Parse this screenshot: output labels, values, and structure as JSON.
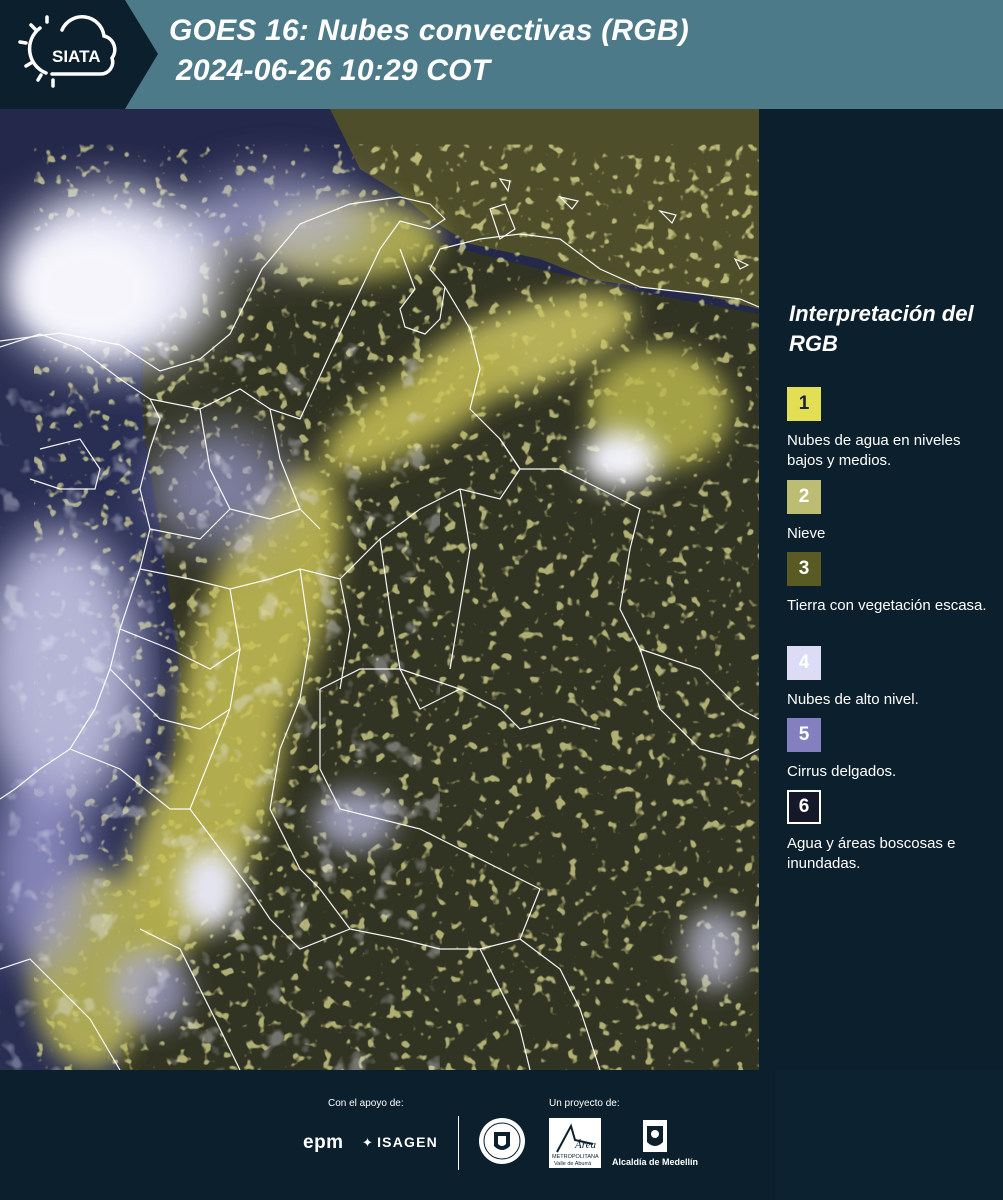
{
  "header": {
    "logo_text": "SIATA",
    "title_line1": "GOES 16: Nubes convectivas (RGB)",
    "title_line2": "2024-06-26 10:29 COT",
    "background_color": "#4d7a88",
    "logo_background_color": "#0b1f2c"
  },
  "map": {
    "product": "GOES 16 Nubes convectivas (RGB)",
    "boundary_color": "#ffffff",
    "palette": {
      "low_clouds": "#e2df57",
      "high_clouds": "#dcdcf4",
      "vegetation": "#363823",
      "forest_water": "#1d2040"
    }
  },
  "legend": {
    "title": "Interpretación del RGB",
    "items": [
      {
        "number": "1",
        "label": "Nubes de agua en niveles bajos y medios.",
        "color": "#e3df55"
      },
      {
        "number": "2",
        "label": "Nieve",
        "color": "#bcbd72"
      },
      {
        "number": "3",
        "label": "Tierra con vegetación escasa.",
        "color": "#5a5a24"
      },
      {
        "number": "4",
        "label": "Nubes de alto nivel.",
        "color": "#dcdcf6"
      },
      {
        "number": "5",
        "label": "Cirrus delgados.",
        "color": "#8480c0"
      },
      {
        "number": "6",
        "label": "Agua y áreas boscosas e inundadas.",
        "color": "#151828"
      }
    ]
  },
  "footer": {
    "support_caption": "Con el apoyo de:",
    "project_caption": "Un proyecto de:",
    "support_logos": [
      "epm",
      "ISAGEN"
    ],
    "project_logos": {
      "area": "Área",
      "area_sub1": "METROPOLITANA",
      "area_sub2": "Valle de Aburrá",
      "alcaldia": "Alcaldía de Medellín"
    }
  }
}
